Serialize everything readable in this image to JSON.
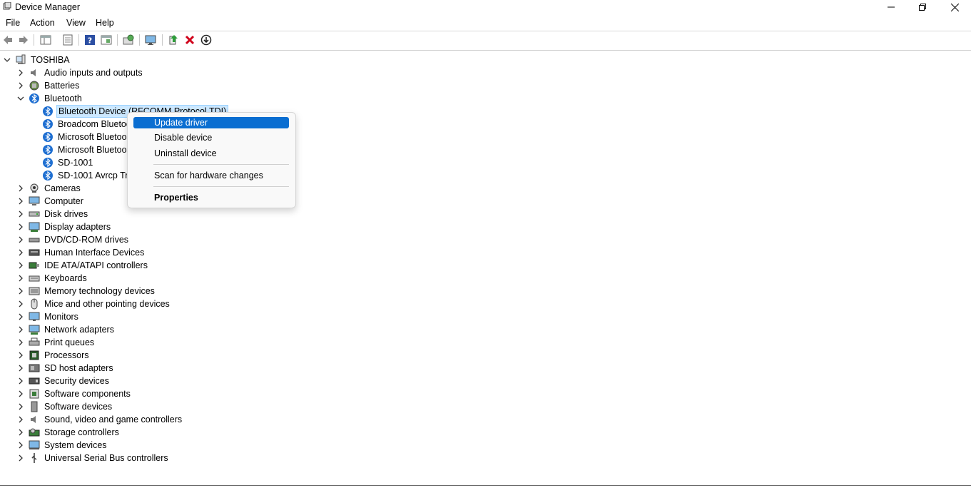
{
  "window": {
    "title": "Device Manager",
    "icon": "device-manager-icon"
  },
  "menu": [
    "File",
    "Action",
    "View",
    "Help"
  ],
  "toolbar_icons": [
    "back-icon",
    "forward-icon",
    "show-hide-tree-icon",
    "properties-icon",
    "help-icon",
    "console-tree-icon",
    "scan-hardware-icon",
    "monitor-icon",
    "update-driver-icon",
    "uninstall-icon",
    "disable-icon"
  ],
  "tree": {
    "root": "TOSHIBA",
    "categories": [
      {
        "label": "Audio inputs and outputs",
        "icon": "speaker-icon"
      },
      {
        "label": "Batteries",
        "icon": "battery-icon"
      },
      {
        "label": "Bluetooth",
        "icon": "bluetooth-icon",
        "expanded": true
      },
      {
        "label": "Cameras",
        "icon": "camera-icon"
      },
      {
        "label": "Computer",
        "icon": "computer-icon"
      },
      {
        "label": "Disk drives",
        "icon": "disk-icon"
      },
      {
        "label": "Display adapters",
        "icon": "display-adapter-icon"
      },
      {
        "label": "DVD/CD-ROM drives",
        "icon": "dvd-icon"
      },
      {
        "label": "Human Interface Devices",
        "icon": "hid-icon"
      },
      {
        "label": "IDE ATA/ATAPI controllers",
        "icon": "ide-icon"
      },
      {
        "label": "Keyboards",
        "icon": "keyboard-icon"
      },
      {
        "label": "Memory technology devices",
        "icon": "memory-icon"
      },
      {
        "label": "Mice and other pointing devices",
        "icon": "mouse-icon"
      },
      {
        "label": "Monitors",
        "icon": "monitor-icon"
      },
      {
        "label": "Network adapters",
        "icon": "network-icon"
      },
      {
        "label": "Print queues",
        "icon": "printer-icon"
      },
      {
        "label": "Processors",
        "icon": "processor-icon"
      },
      {
        "label": "SD host adapters",
        "icon": "sd-icon"
      },
      {
        "label": "Security devices",
        "icon": "security-icon"
      },
      {
        "label": "Software components",
        "icon": "software-component-icon"
      },
      {
        "label": "Software devices",
        "icon": "software-device-icon"
      },
      {
        "label": "Sound, video and game controllers",
        "icon": "sound-icon"
      },
      {
        "label": "Storage controllers",
        "icon": "storage-icon"
      },
      {
        "label": "System devices",
        "icon": "system-icon"
      },
      {
        "label": "Universal Serial Bus controllers",
        "icon": "usb-icon"
      }
    ],
    "bluetooth_children": [
      "Bluetooth Device (RFCOMM Protocol TDI)",
      "Broadcom Bluetoo",
      "Microsoft Bluetoo",
      "Microsoft Bluetoo",
      "SD-1001",
      "SD-1001 Avrcp Tra"
    ]
  },
  "context_menu": {
    "items": [
      "Update driver",
      "Disable device",
      "Uninstall device",
      "Scan for hardware changes",
      "Properties"
    ],
    "highlight_color": "#0a6ed1"
  },
  "colors": {
    "bluetooth": "#1f6fd1",
    "selection": "#cce8ff"
  }
}
